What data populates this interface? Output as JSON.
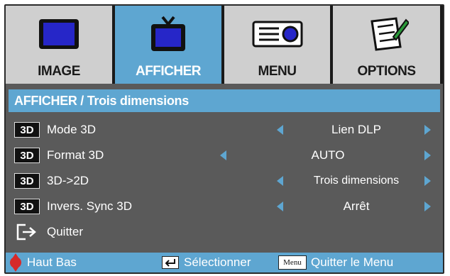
{
  "tabs": [
    {
      "label": "IMAGE",
      "icon": "monitor-icon",
      "active": false
    },
    {
      "label": "AFFICHER",
      "icon": "tv-icon",
      "active": true
    },
    {
      "label": "MENU",
      "icon": "projector-icon",
      "active": false
    },
    {
      "label": "OPTIONS",
      "icon": "checklist-icon",
      "active": false
    }
  ],
  "section_title": "AFFICHER / Trois dimensions",
  "rows": [
    {
      "badge": "3D",
      "label": "Mode 3D",
      "value": "Lien DLP"
    },
    {
      "badge": "3D",
      "label": "Format 3D",
      "value": "AUTO"
    },
    {
      "badge": "3D",
      "label": "3D->2D",
      "value": "Trois dimensions"
    },
    {
      "badge": "3D",
      "label": "Invers. Sync 3D",
      "value": "Arrêt"
    }
  ],
  "exit_label": "Quitter",
  "footer": {
    "updown_label": "Haut Bas",
    "select_label": "Sélectionner",
    "menu_key": "Menu",
    "quit_menu_label": "Quitter le Menu"
  },
  "colors": {
    "accent": "#5ea6d1",
    "panel": "#5a5a5a",
    "tab_inactive": "#cfcfcf",
    "updown": "#d62a2a"
  }
}
